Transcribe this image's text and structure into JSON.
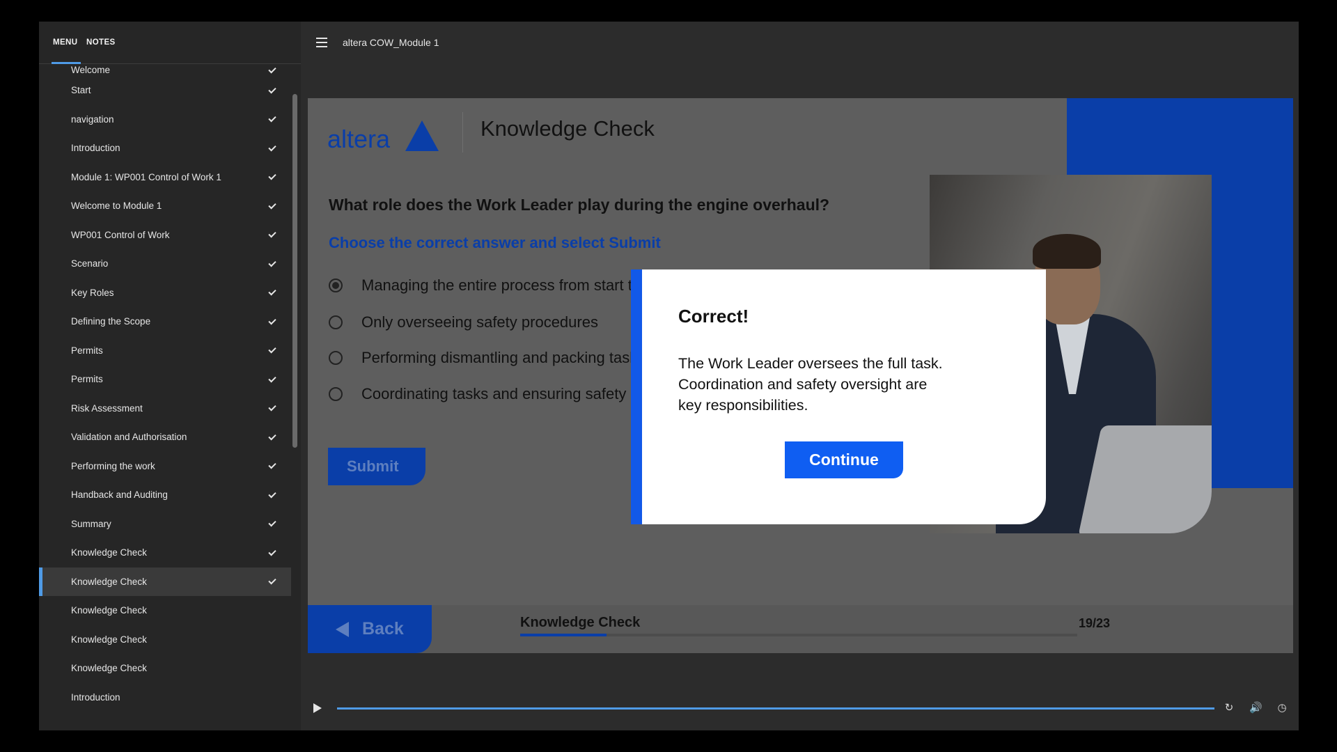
{
  "sidebar": {
    "tabs": {
      "menu": "MENU",
      "notes": "NOTES"
    },
    "items": [
      {
        "label": "Welcome",
        "completed": true
      },
      {
        "label": "Start",
        "completed": true
      },
      {
        "label": "navigation",
        "completed": true
      },
      {
        "label": "Introduction",
        "completed": true
      },
      {
        "label": "Module 1: WP001 Control of Work 1",
        "completed": true
      },
      {
        "label": "Welcome to Module 1",
        "completed": true
      },
      {
        "label": "WP001 Control of Work",
        "completed": true
      },
      {
        "label": "Scenario",
        "completed": true
      },
      {
        "label": "Key Roles",
        "completed": true
      },
      {
        "label": "Defining the Scope",
        "completed": true
      },
      {
        "label": "Permits",
        "completed": true
      },
      {
        "label": "Permits",
        "completed": true
      },
      {
        "label": "Risk Assessment",
        "completed": true
      },
      {
        "label": "Validation and Authorisation",
        "completed": true
      },
      {
        "label": "Performing the work",
        "completed": true
      },
      {
        "label": "Handback and Auditing",
        "completed": true
      },
      {
        "label": "Summary",
        "completed": true
      },
      {
        "label": "Knowledge Check",
        "completed": true
      },
      {
        "label": "Knowledge Check",
        "completed": true,
        "active": true
      },
      {
        "label": "Knowledge Check",
        "completed": false
      },
      {
        "label": "Knowledge Check",
        "completed": false
      },
      {
        "label": "Knowledge Check",
        "completed": false
      },
      {
        "label": "Introduction",
        "completed": false
      }
    ]
  },
  "topbar": {
    "course_title": "altera COW_Module 1",
    "menu_icon": "hamburger-icon"
  },
  "slide": {
    "logo_text": "altera",
    "heading": "Knowledge Check",
    "question": "What role does the Work Leader play during the engine overhaul?",
    "instruction": "Choose the correct answer and select Submit",
    "options": [
      {
        "label": "Managing the entire process from start to finish",
        "selected": true
      },
      {
        "label": "Only overseeing safety procedures",
        "selected": false
      },
      {
        "label": "Performing dismantling and packing tasks",
        "selected": false
      },
      {
        "label": "Coordinating tasks and ensuring safety",
        "selected": false
      }
    ],
    "submit_label": "Submit"
  },
  "nav": {
    "back_label": "Back",
    "title": "Knowledge Check",
    "count": "19/23",
    "progress": 0.155
  },
  "modal": {
    "title": "Correct!",
    "body_lines": [
      "The Work Leader oversees the full task.",
      "Coordination and safety oversight are",
      "key responsibilities."
    ],
    "continue_label": "Continue"
  },
  "playbar": {
    "progress": 1.0,
    "icons": [
      "play-icon",
      "replay-icon",
      "volume-icon",
      "playback-speed-icon"
    ]
  },
  "colors": {
    "brand_blue": "#0a3ea8",
    "accent_blue": "#1259e8",
    "menu_highlight": "#4f9be6"
  }
}
